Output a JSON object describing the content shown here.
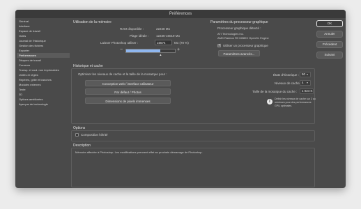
{
  "window": {
    "title": "Préférences"
  },
  "nav": {
    "items": [
      {
        "label": "Général",
        "selected": false
      },
      {
        "label": "Interface",
        "selected": false
      },
      {
        "label": "Espace de travail",
        "selected": false
      },
      {
        "label": "Outils",
        "selected": false
      },
      {
        "label": "Journal de l'historique",
        "selected": false
      },
      {
        "label": "Gestion des fichiers",
        "selected": false
      },
      {
        "label": "Exporter",
        "selected": false
      },
      {
        "label": "Performances",
        "selected": true
      },
      {
        "label": "Disques de travail",
        "selected": false
      },
      {
        "label": "Curseurs",
        "selected": false
      },
      {
        "label": "Transp. et coul. non imprimables",
        "selected": false
      },
      {
        "label": "Unités et règles",
        "selected": false
      },
      {
        "label": "Repères, grille et tranches",
        "selected": false
      },
      {
        "label": "Modules externes",
        "selected": false
      },
      {
        "label": "Texte",
        "selected": false
      },
      {
        "label": "3D",
        "selected": false
      },
      {
        "label": "Options améliorées",
        "selected": false
      },
      {
        "label": "Aperçus de technologie",
        "selected": false
      }
    ]
  },
  "memory": {
    "title": "Utilisation de la mémoire",
    "ram_label": "RAM disponible :",
    "ram_value": "22248 Mo",
    "ideal_label": "Plage idéale :",
    "ideal_value": "12236-16019 Mo",
    "let_label": "Laisser Photoshop utiliser :",
    "let_value": "15574",
    "let_suffix": "Mo (70 %)",
    "minus": "−",
    "plus": "+",
    "usage_fraction": 0.7
  },
  "gpu": {
    "title": "Paramètres du processeur graphique",
    "detected_label": "Processeur graphique détecté :",
    "vendor": "ATI Technologies Inc.",
    "model": "AMD Radeon R9 M380X OpenGL Engine",
    "use_label": "Utiliser un processeur graphique",
    "use_checked": true,
    "advanced_button": "Paramètres avancés..."
  },
  "history": {
    "title": "Historique et cache",
    "optimize_label": "Optimiser les niveaux de cache et la taille de la mosaïque pour :",
    "buttons": [
      "Conception web / interface utilisateur",
      "Par défaut / Photos",
      "Dimensions de pixels immenses"
    ],
    "states_label": "États d'historique :",
    "states_value": "50",
    "cache_label": "Niveaux de cache :",
    "cache_value": "4",
    "tile_label": "Taille de la mosaïque du cache :",
    "tile_value": "1 024 K",
    "info_icon": "i",
    "info_text_1": "Définir les niveaux de cache sur 2 au",
    "info_text_2": "minimum pour des performances",
    "info_text_3": "GPU optimales."
  },
  "options": {
    "title": "Options",
    "composition_label": "Composition hiérité",
    "composition_checked": false
  },
  "description": {
    "title": "Description",
    "text": "Mémoire affectée à Photoshop. Les modifications prennent effet au prochain démarrage de Photoshop."
  },
  "actions": {
    "ok": "OK",
    "cancel": "Annuler",
    "prev": "Précédent",
    "next": "Suivant"
  }
}
